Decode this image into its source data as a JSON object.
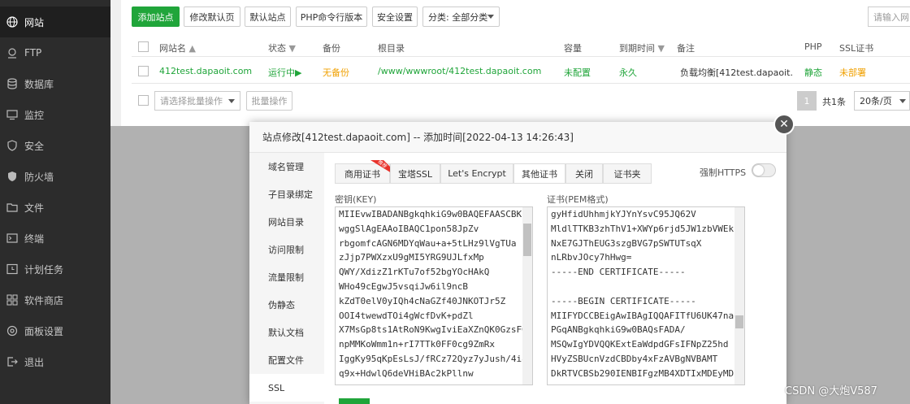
{
  "sidebar": {
    "items": [
      {
        "label": "网站",
        "icon": "globe-icon",
        "active": true
      },
      {
        "label": "FTP",
        "icon": "ftp-icon"
      },
      {
        "label": "数据库",
        "icon": "database-icon"
      },
      {
        "label": "监控",
        "icon": "monitor-icon"
      },
      {
        "label": "安全",
        "icon": "shield-icon"
      },
      {
        "label": "防火墙",
        "icon": "firewall-icon"
      },
      {
        "label": "文件",
        "icon": "folder-icon"
      },
      {
        "label": "终端",
        "icon": "terminal-icon"
      },
      {
        "label": "计划任务",
        "icon": "clock-icon"
      },
      {
        "label": "软件商店",
        "icon": "store-icon"
      },
      {
        "label": "面板设置",
        "icon": "settings-icon"
      },
      {
        "label": "退出",
        "icon": "logout-icon"
      }
    ]
  },
  "toolbar": {
    "add_site": "添加站点",
    "edit_default_page": "修改默认页",
    "default_site": "默认站点",
    "php_cli": "PHP命令行版本",
    "security": "安全设置",
    "category": "分类: 全部分类",
    "search_placeholder": "请输入网"
  },
  "table": {
    "headers": {
      "name": "网站名",
      "status": "状态",
      "backup": "备份",
      "root": "根目录",
      "capacity": "容量",
      "expire": "到期时间",
      "remark": "备注",
      "php": "PHP",
      "ssl": "SSL证书"
    },
    "row": {
      "name": "412test.dapaoit.com",
      "status": "运行中",
      "backup": "无备份",
      "root": "/www/wwwroot/412test.dapaoit.com",
      "capacity": "未配置",
      "expire": "永久",
      "remark": "负载均衡[412test.dapaoit.cor",
      "php": "静态",
      "ssl": "未部署"
    }
  },
  "footer": {
    "batch_placeholder": "请选择批量操作",
    "batch_button": "批量操作",
    "page_current": "1",
    "total": "共1条",
    "per_page": "20条/页"
  },
  "modal": {
    "title": "站点修改[412test.dapaoit.com] -- 添加时间[2022-04-13 14:26:43]",
    "menu": [
      "域名管理",
      "子目录绑定",
      "网站目录",
      "访问限制",
      "流量限制",
      "伪静态",
      "默认文档",
      "配置文件",
      "SSL"
    ],
    "tabs": [
      "商用证书",
      "宝塔SSL",
      "Let's Encrypt",
      "其他证书",
      "关闭",
      "证书夹"
    ],
    "hot_badge": "推荐",
    "force_https": "强制HTTPS",
    "key_label": "密钥(KEY)",
    "cert_label": "证书(PEM格式)",
    "key_lines": [
      "MIIEvwIBADANBgkqhkiG9w0BAQEFAASCBKk",
      "wggSlAgEAAoIBAQC1pon58JpZv",
      "rbgomfcAGN6MDYqWau+a+5tLHz9lVgTUa",
      "zJjp7PWXzxU9gMI5YRG9UJLfxMp",
      "QWY/XdizZ1rKTu7of52bgYOcHAkQ",
      "WHo49cEgwJ5vsqiJw6il9ncB",
      "kZdT0elV0yIQh4cNaGZf40JNKOTJr5Z",
      "OOI4twewdTOi4gWcfDvK+pdZl",
      "X7MsGp8ts1AtRoN9KwgIviEaXZnQK0GzsFG",
      "npMMKoWmm1n+rI7TTk0FF0cg9ZmRx",
      "IggKy95qKpEsLsJ/fRCz72Qyz7yJush/4i8c+jM",
      "q9x+HdwlQ6deVHiBAc2kPllnw"
    ],
    "cert_lines": [
      "gyHfidUhhmjkYJYnYsvC95JQ62V",
      "MldlTTKB3zhThV1+XWYp6rjd5JW1zbVWEkL",
      "NxE7GJThEUG3szgBVG7pSWTUTsqX",
      "nLRbvJOcy7hHwg=",
      "-----END CERTIFICATE-----",
      "",
      "-----BEGIN CERTIFICATE-----",
      "MIIFYDCCBEigAwIBAgIQQAFITfU6UK47naq",
      "PGqANBgkqhkiG9w0BAQsFADA/",
      "MSQwIgYDVQQKExtEaWdpdGFsIFNpZ25hd",
      "HVyZSBUcnVzdCBDby4xFzAVBgNVBAMT",
      "DkRTVCBSb290IENBIFgzMB4XDTIxMDEyMD"
    ]
  },
  "watermark": "CSDN @大炮V587"
}
